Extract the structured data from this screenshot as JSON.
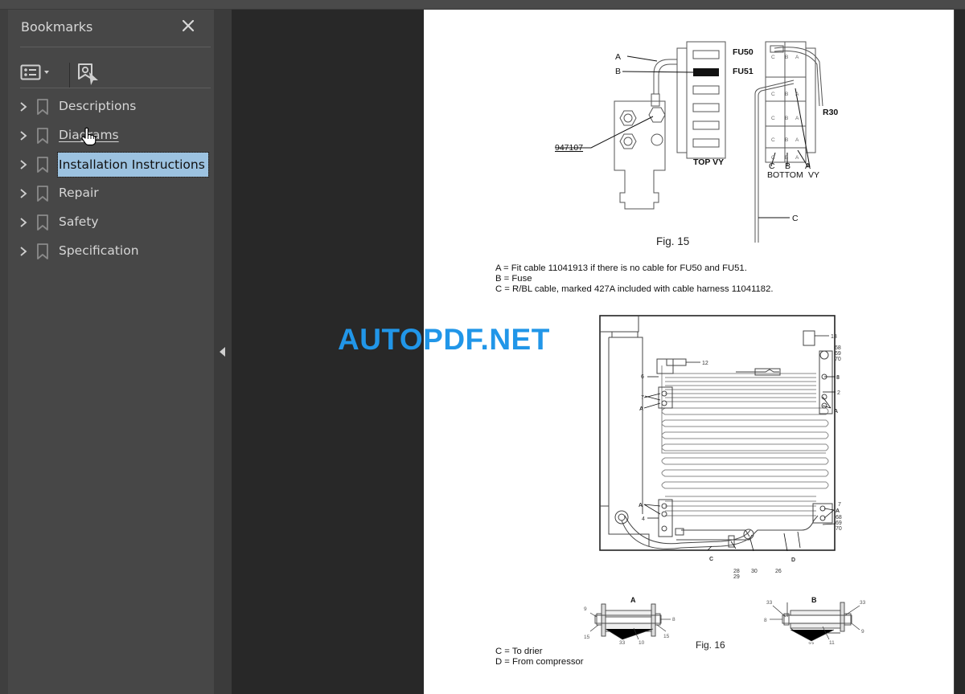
{
  "window": {
    "topbar": ""
  },
  "bookmarks_panel": {
    "title": "Bookmarks",
    "close_icon": "close-icon",
    "toolbar": {
      "options_icon": "list-options-icon",
      "options_dropdown_icon": "caret-down-icon",
      "find_bookmark_icon": "find-current-bookmark-icon"
    },
    "items": [
      {
        "label": "Descriptions",
        "state": "normal"
      },
      {
        "label": "Diagrams",
        "state": "hover"
      },
      {
        "label": "Installation Instructions",
        "state": "selected"
      },
      {
        "label": "Repair",
        "state": "normal"
      },
      {
        "label": "Safety",
        "state": "normal"
      },
      {
        "label": "Specification",
        "state": "normal"
      }
    ]
  },
  "collapse_panel_icon": "triangle-left-icon",
  "watermark": "AUTOPDF.NET",
  "document": {
    "fig15": {
      "caption": "Fig. 15",
      "labels": {
        "a": "A",
        "b": "B",
        "part": "947107",
        "fu50": "FU50",
        "fu51": "FU51",
        "top": "TOP VY",
        "r30": "R30",
        "c_bottom": "C",
        "b_bottom": "B",
        "a_bottom": "A",
        "bottom": "BOTTOM",
        "vy": "VY",
        "c_line": "C",
        "slot_c": "C",
        "slot_b": "B",
        "slot_a": "A"
      },
      "legend": [
        "A = Fit cable 11041913 if there is no cable for FU50 and FU51.",
        "B = Fuse",
        "C = R/BL cable, marked 427A included with cable harness 11041182."
      ]
    },
    "fig16": {
      "caption": "Fig. 16",
      "labels": {
        "n13": "13",
        "n68_69_70_top": [
          "68",
          "69",
          "70"
        ],
        "n12": "12",
        "n6": "6",
        "n8": "8",
        "n2": "2",
        "n7_left": "7",
        "a_left_top": "A",
        "a_right_top": "A",
        "a_left_bottom": "A",
        "n4": "4",
        "n7_right": "7",
        "a_right_bottom": "A",
        "n68_69_70_bottom": [
          "68",
          "69",
          "70"
        ],
        "c": "C",
        "d": "D",
        "n28_29": [
          "28",
          "29"
        ],
        "n30": "30",
        "n26": "26"
      },
      "detail_a": {
        "title": "A",
        "labels": [
          "9",
          "8",
          "15",
          "15",
          "33",
          "10"
        ]
      },
      "detail_b": {
        "title": "B",
        "labels": [
          "33",
          "33",
          "8",
          "9",
          "33",
          "11"
        ]
      },
      "legend": [
        "C = To drier",
        "D = From compressor"
      ]
    }
  }
}
